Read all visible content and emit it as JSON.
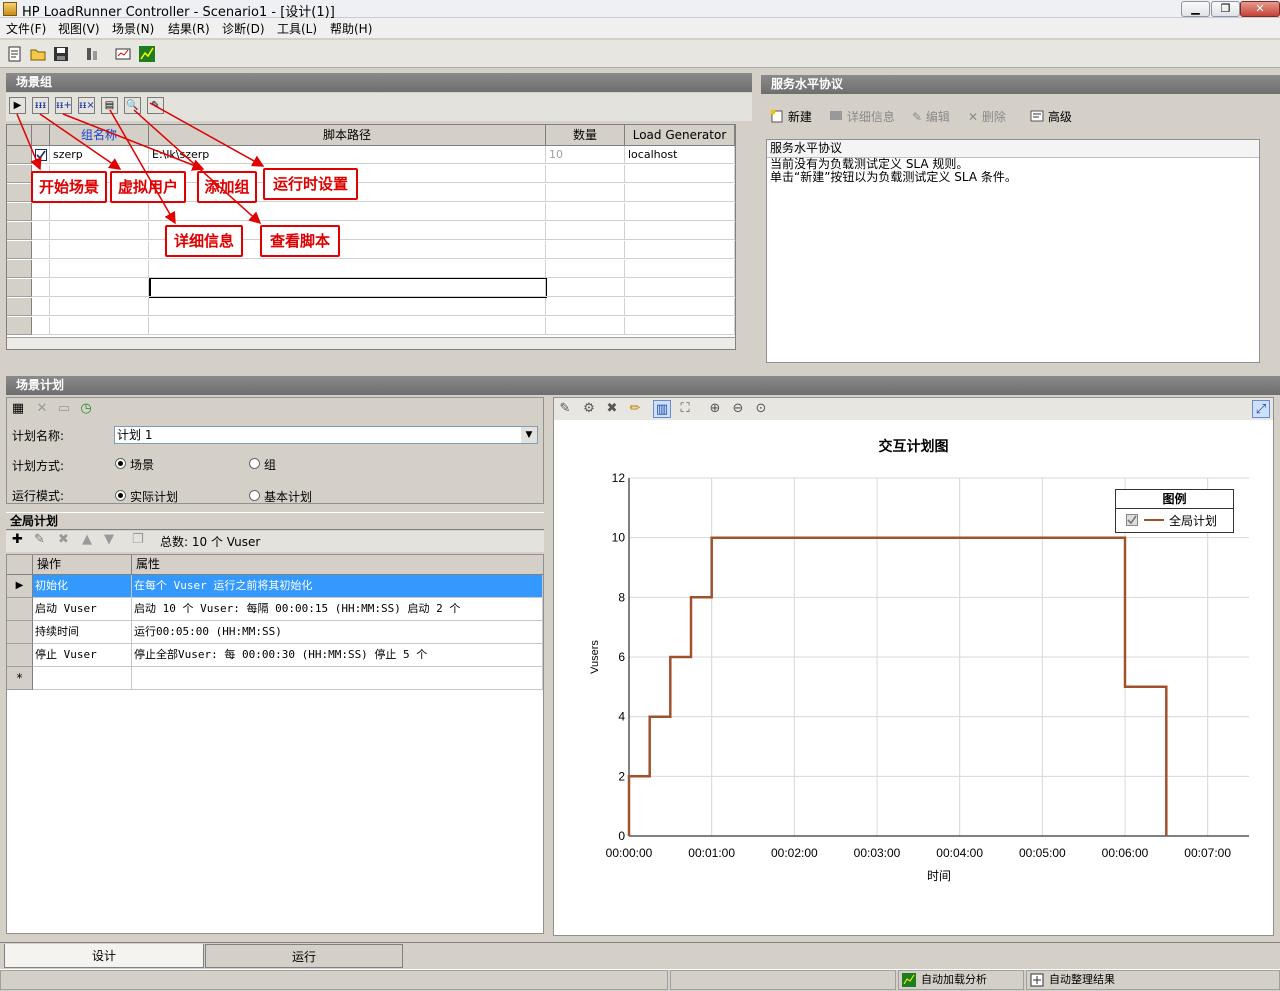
{
  "window": {
    "title": "HP LoadRunner Controller - Scenario1 - [设计(1)]",
    "buttons": [
      "▁",
      "❐",
      "✕"
    ]
  },
  "menu": [
    "文件(F)",
    "视图(V)",
    "场景(N)",
    "结果(R)",
    "诊断(D)",
    "工具(L)",
    "帮助(H)"
  ],
  "toolbar_icons": [
    "new-scenario-icon",
    "open-icon",
    "save-icon",
    "compare-icon",
    "scenario-icon",
    "analysis-icon"
  ],
  "scenario_groups": {
    "title": "场景组",
    "toolbar": [
      "▶",
      "ᵻᵻᵻ",
      "ᵻᵻ+",
      "ᵻᵻ×",
      "▤",
      "🔍",
      "✎"
    ],
    "columns": [
      "组名称",
      "脚本路径",
      "数量",
      "Load Generator"
    ],
    "rows": [
      {
        "checked": true,
        "name": "szerp",
        "path": "E:\\lk\\szerp",
        "qty": "10",
        "generator": "localhost"
      }
    ]
  },
  "callouts": {
    "start": "开始场景",
    "vusers": "虚拟用户",
    "add_group": "添加组",
    "runtime": "运行时设置",
    "details": "详细信息",
    "view_script": "查看脚本"
  },
  "sla": {
    "title": "服务水平协议",
    "buttons": {
      "new": "新建",
      "details": "详细信息",
      "edit": "编辑",
      "delete": "删除",
      "advanced": "高级"
    },
    "box_title": "服务水平协议",
    "line1": "当前没有为负载测试定义 SLA 规则。",
    "line2": "单击“新建”按钮以为负载测试定义 SLA 条件。"
  },
  "schedule": {
    "title": "场景计划",
    "name_label": "计划名称:",
    "name_value": "计划 1",
    "mode_label": "计划方式:",
    "mode_options": [
      "场景",
      "组"
    ],
    "run_label": "运行模式:",
    "run_options": [
      "实际计划",
      "基本计划"
    ],
    "global_title": "全局计划",
    "total": "总数: 10 个 Vuser",
    "columns": [
      "操作",
      "属性"
    ],
    "actions": [
      {
        "op": "初始化",
        "prop": "在每个 Vuser 运行之前将其初始化"
      },
      {
        "op": "启动 Vuser",
        "prop": "启动 10 个 Vuser: 每隔 00:00:15 (HH:MM:SS) 启动 2 个"
      },
      {
        "op": "持续时间",
        "prop": "运行00:05:00 (HH:MM:SS)"
      },
      {
        "op": "停止 Vuser",
        "prop": "停止全部Vuser: 每 00:00:30 (HH:MM:SS) 停止 5 个"
      }
    ],
    "new_row_marker": "*"
  },
  "chart_data": {
    "type": "line",
    "title": "交互计划图",
    "xlabel": "时间",
    "ylabel": "Vusers",
    "xlim": [
      0,
      450
    ],
    "ylim": [
      0,
      12
    ],
    "x_ticks": [
      0,
      60,
      120,
      180,
      240,
      300,
      360,
      420
    ],
    "x_tick_labels": [
      "00:00:00",
      "00:01:00",
      "00:02:00",
      "00:03:00",
      "00:04:00",
      "00:05:00",
      "00:06:00",
      "00:07:00"
    ],
    "y_ticks": [
      0,
      2,
      4,
      6,
      8,
      10,
      12
    ],
    "y_tick_labels": [
      "0",
      "2",
      "4",
      "6",
      "8",
      "10",
      "12"
    ],
    "grid": true,
    "legend": {
      "title": "图例",
      "placement": "top-right"
    },
    "series": [
      {
        "name": "全局计划",
        "color": "#a0522d",
        "x": [
          0,
          0,
          15,
          15,
          30,
          30,
          45,
          45,
          60,
          60,
          360,
          360,
          390,
          390
        ],
        "y": [
          0,
          2,
          2,
          4,
          4,
          6,
          6,
          8,
          8,
          10,
          10,
          5,
          5,
          0
        ]
      }
    ]
  },
  "tabs": [
    "设计",
    "运行"
  ],
  "status": {
    "auto_analysis": "自动加载分析",
    "auto_collate": "自动整理结果"
  }
}
